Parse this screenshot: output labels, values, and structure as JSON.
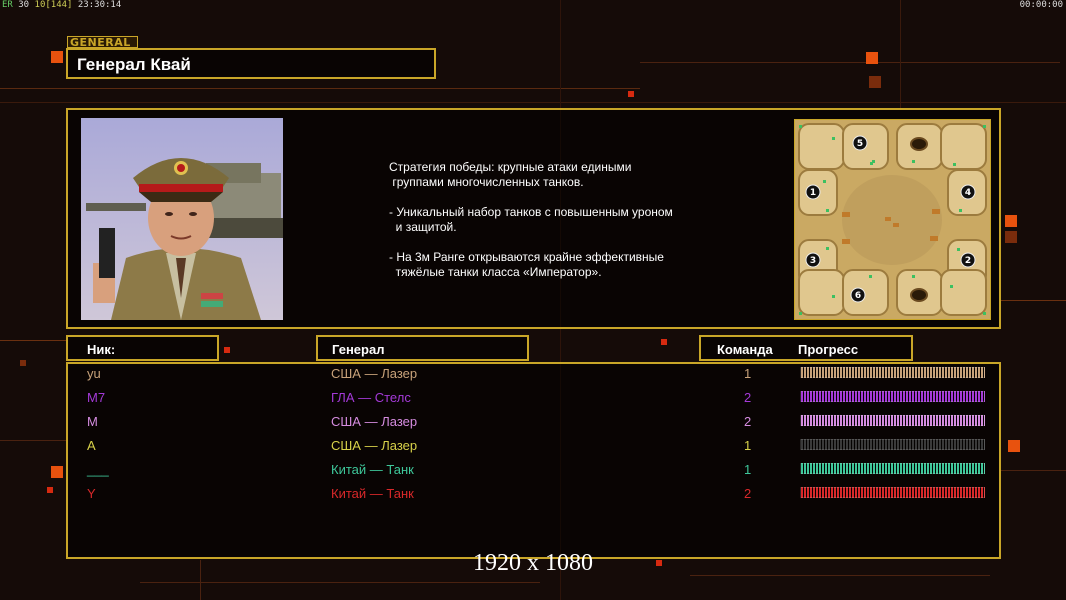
{
  "hud": {
    "left_prefix": "ER",
    "left_a": "30",
    "left_b": "10",
    "left_c": "[144]",
    "left_time": "23:30:14",
    "right_time": "00:00:00"
  },
  "general": {
    "tag": "GENERAL",
    "name": "Генерал Квай",
    "description": "Стратегия победы: крупные атаки едиными\n группами многочисленных танков.\n\n- Уникальный набор танков с повышенным уроном\n  и защитой.\n\n- На 3м Ранге открываются крайне эффективные\n  тяжёлые танки класса «Император»."
  },
  "minimap": {
    "start_positions": [
      "1",
      "2",
      "3",
      "4",
      "5",
      "6"
    ]
  },
  "table": {
    "col_nick": "Ник:",
    "col_general": "Генерал",
    "col_team": "Команда",
    "col_progress": "Прогресс"
  },
  "players": [
    {
      "nick": "yu",
      "general": "США — Лазер",
      "team": "1",
      "color": "#c8a27a",
      "progress": 1.0
    },
    {
      "nick": "M7",
      "general": "ГЛА — Стелс",
      "team": "2",
      "color": "#a43ad8",
      "progress": 1.0
    },
    {
      "nick": "M",
      "general": "США — Лазер",
      "team": "2",
      "color": "#d58ce0",
      "progress": 1.0
    },
    {
      "nick": "A",
      "general": "США — Лазер",
      "team": "1",
      "color": "#d8d24a",
      "progress": 0.0
    },
    {
      "nick": "___",
      "general": "Китай — Танк",
      "team": "1",
      "color": "#3ec79a",
      "progress": 1.0
    },
    {
      "nick": "Y",
      "general": "Китай — Танк",
      "team": "2",
      "color": "#d8282a",
      "progress": 1.0
    }
  ],
  "resolution_text": "1920 x 1080"
}
